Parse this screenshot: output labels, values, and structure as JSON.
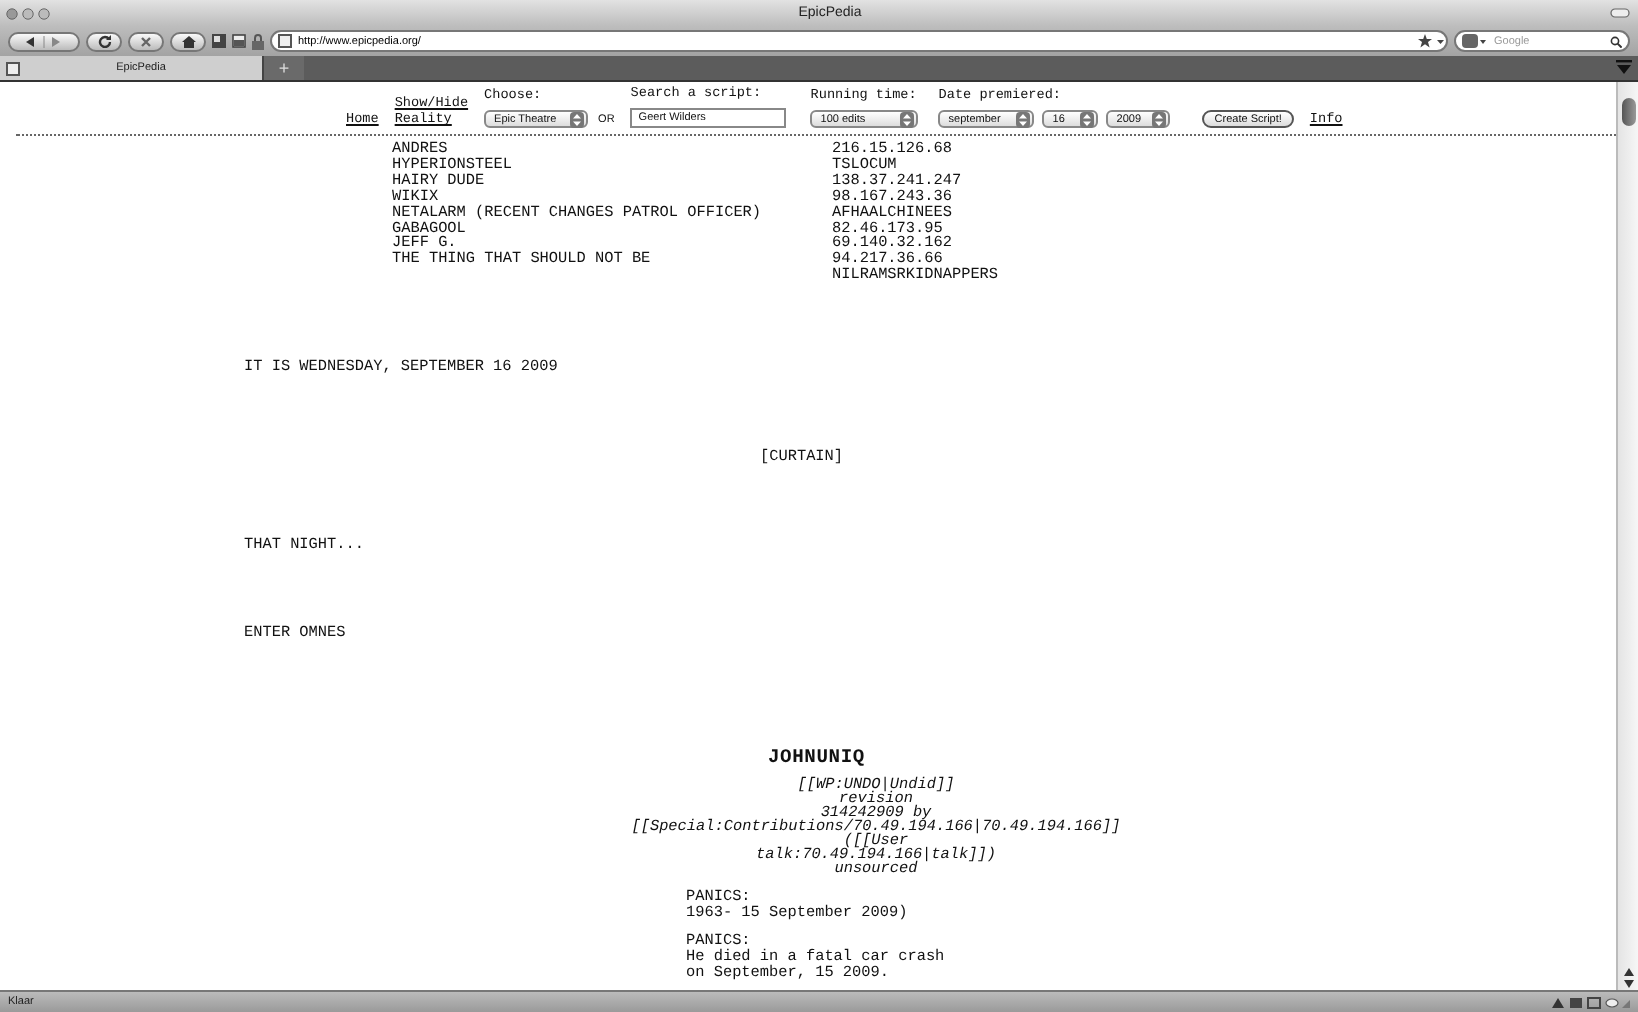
{
  "window": {
    "title": "EpicPedia"
  },
  "toolbar": {
    "url": "http://www.epicpedia.org/",
    "search_placeholder": "Google"
  },
  "tabs": [
    {
      "label": "EpicPedia",
      "selected": true
    }
  ],
  "new_tab_button": "+",
  "nav": {
    "home_link": "Home",
    "toggle_link": [
      "Show/Hide",
      "Reality"
    ],
    "choose": {
      "label": "Choose:",
      "value": "Epic Theatre"
    },
    "or_label": "OR",
    "search": {
      "label": "Search a script:",
      "value": "Geert Wilders"
    },
    "running_time": {
      "label": "Running time:",
      "value": "100 edits"
    },
    "date": {
      "label": "Date premiered:",
      "month": "september",
      "day": "16",
      "year": "2009"
    },
    "create_button": "Create Script!",
    "info_link": "Info"
  },
  "cast": {
    "column_1": [
      "ANDRES",
      "HYPERIONSTEEL",
      "HAIRY DUDE",
      "WIKIX",
      "NETALARM (RECENT CHANGES PATROL OFFICER)",
      "GABAGOOL",
      "JEFF G.",
      "THE THING THAT SHOULD NOT BE"
    ],
    "column_2": [
      "216.15.126.68",
      "TSLOCUM",
      "138.37.241.247",
      "98.167.243.36",
      "AFHAALCHINEES",
      "82.46.173.95",
      "69.140.32.162",
      "94.217.36.66",
      "NILRAMSRKIDNAPPERS"
    ]
  },
  "script": [
    {
      "kind": "scene",
      "lines": [
        "IT IS WEDNESDAY, SEPTEMBER 16 2009"
      ]
    },
    {
      "kind": "curtain",
      "lines": [
        "[CURTAIN]"
      ]
    },
    {
      "kind": "direction",
      "lines": [
        "THAT NIGHT..."
      ]
    },
    {
      "kind": "direction",
      "lines": [
        "ENTER OMNES"
      ]
    },
    {
      "kind": "character",
      "lines": [
        "JOHNUNIQ"
      ]
    },
    {
      "kind": "note",
      "lines": [
        "[[WP:UNDO|Undid]]",
        "revision",
        "314242909 by",
        "[[Special:Contributions/70.49.194.166|70.49.194.166]]",
        "([[User",
        "talk:70.49.194.166|talk]])",
        "unsourced"
      ]
    },
    {
      "kind": "speech",
      "lines": [
        "PANICS:",
        "1963- 15 September 2009)"
      ]
    },
    {
      "kind": "speech",
      "lines": [
        "PANICS:",
        "He died in a fatal car crash",
        "on September, 15 2009."
      ]
    }
  ],
  "status_bar": "Klaar"
}
